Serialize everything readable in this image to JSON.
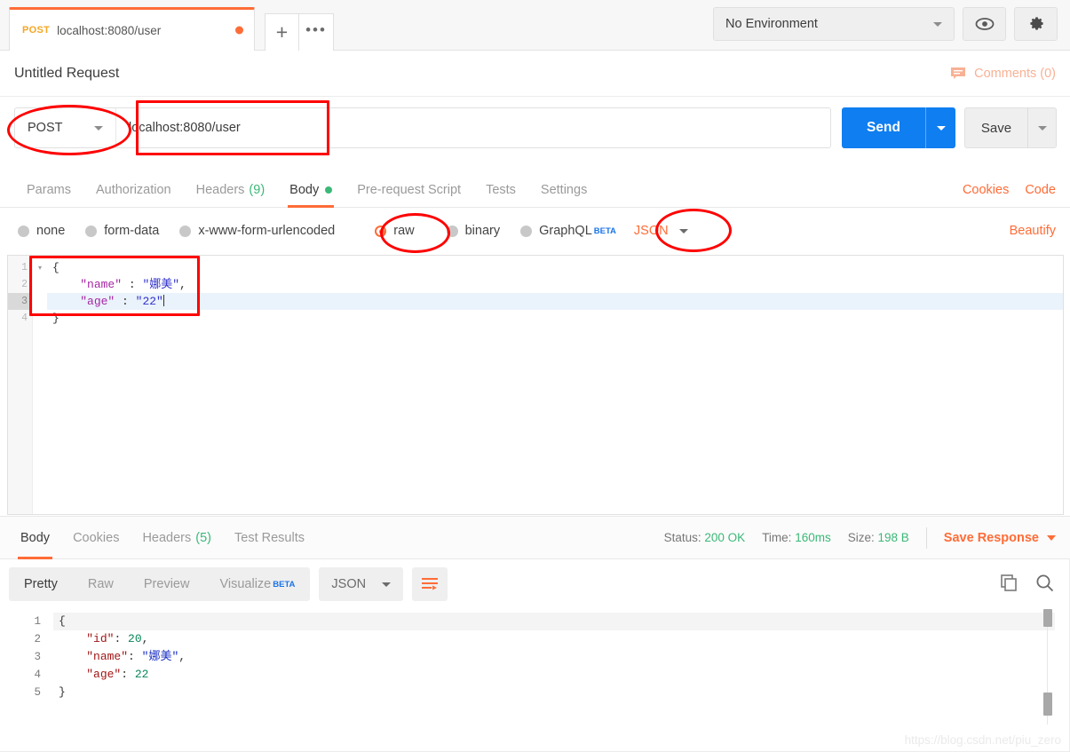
{
  "topbar": {
    "tab": {
      "method": "POST",
      "name": "localhost:8080/user",
      "unsaved_dot": "●"
    },
    "new_tab_label": "+",
    "more_label": "•••",
    "environment": {
      "value": "No Environment"
    },
    "eye_icon": "eye-icon",
    "settings_icon": "gear-icon"
  },
  "request": {
    "title": "Untitled Request",
    "comments_label": "Comments (0)",
    "method": "POST",
    "url": "localhost:8080/user",
    "send_label": "Send",
    "save_label": "Save",
    "tabs": [
      {
        "label": "Params",
        "active": false
      },
      {
        "label": "Authorization",
        "active": false
      },
      {
        "label": "Headers",
        "count": "(9)",
        "active": false
      },
      {
        "label": "Body",
        "active": true,
        "dot": true
      },
      {
        "label": "Pre-request Script",
        "active": false
      },
      {
        "label": "Tests",
        "active": false
      },
      {
        "label": "Settings",
        "active": false
      }
    ],
    "right_links": [
      "Cookies",
      "Code"
    ],
    "body_types": [
      {
        "label": "none",
        "selected": false
      },
      {
        "label": "form-data",
        "selected": false
      },
      {
        "label": "x-www-form-urlencoded",
        "selected": false
      },
      {
        "label": "raw",
        "selected": true
      },
      {
        "label": "binary",
        "selected": false
      },
      {
        "label": "GraphQL",
        "selected": false,
        "beta": "BETA"
      }
    ],
    "format_select": "JSON",
    "beautify_label": "Beautify",
    "editor": {
      "line_numbers": [
        "1",
        "2",
        "3",
        "4"
      ],
      "lines": [
        [
          {
            "t": "{",
            "c": "p"
          }
        ],
        [
          {
            "t": "    ",
            "c": "p"
          },
          {
            "t": "\"name\"",
            "c": "k"
          },
          {
            "t": " : ",
            "c": "p"
          },
          {
            "t": "\"娜美\"",
            "c": "s"
          },
          {
            "t": ",",
            "c": "p"
          }
        ],
        [
          {
            "t": "    ",
            "c": "p"
          },
          {
            "t": "\"age\"",
            "c": "k"
          },
          {
            "t": " : ",
            "c": "p"
          },
          {
            "t": "\"22\"",
            "c": "s"
          }
        ],
        [
          {
            "t": "}",
            "c": "p"
          }
        ]
      ],
      "active_line": 3,
      "fold_marker": "▾"
    }
  },
  "response": {
    "tabs": [
      {
        "label": "Body",
        "active": true
      },
      {
        "label": "Cookies",
        "active": false
      },
      {
        "label": "Headers",
        "count": "(5)",
        "active": false
      },
      {
        "label": "Test Results",
        "active": false
      }
    ],
    "status_label": "Status:",
    "status_value": "200 OK",
    "time_label": "Time:",
    "time_value": "160ms",
    "size_label": "Size:",
    "size_value": "198 B",
    "save_response_label": "Save Response",
    "view_modes": [
      {
        "label": "Pretty",
        "active": true
      },
      {
        "label": "Raw",
        "active": false
      },
      {
        "label": "Preview",
        "active": false
      },
      {
        "label": "Visualize",
        "active": false,
        "beta": "BETA"
      }
    ],
    "format_select": "JSON",
    "wrap_icon": "word-wrap-icon",
    "copy_icon": "copy-icon",
    "search_icon": "search-icon",
    "body": {
      "line_numbers": [
        "1",
        "2",
        "3",
        "4",
        "5"
      ],
      "lines": [
        [
          {
            "t": "{",
            "c": "rp"
          }
        ],
        [
          {
            "t": "    ",
            "c": "rp"
          },
          {
            "t": "\"id\"",
            "c": "rk"
          },
          {
            "t": ": ",
            "c": "rp"
          },
          {
            "t": "20",
            "c": "rn"
          },
          {
            "t": ",",
            "c": "rp"
          }
        ],
        [
          {
            "t": "    ",
            "c": "rp"
          },
          {
            "t": "\"name\"",
            "c": "rk"
          },
          {
            "t": ": ",
            "c": "rp"
          },
          {
            "t": "\"娜美\"",
            "c": "rs"
          },
          {
            "t": ",",
            "c": "rp"
          }
        ],
        [
          {
            "t": "    ",
            "c": "rp"
          },
          {
            "t": "\"age\"",
            "c": "rk"
          },
          {
            "t": ": ",
            "c": "rp"
          },
          {
            "t": "22",
            "c": "rn"
          }
        ],
        [
          {
            "t": "}",
            "c": "rp"
          }
        ]
      ]
    }
  },
  "watermark": "https://blog.csdn.net/piu_zero",
  "colors": {
    "accent": "#ff6c37",
    "send_blue": "#0f7ef0",
    "status_green": "#3cb878",
    "annotation_red": "#ff0000",
    "method_orange": "#f5a623"
  }
}
